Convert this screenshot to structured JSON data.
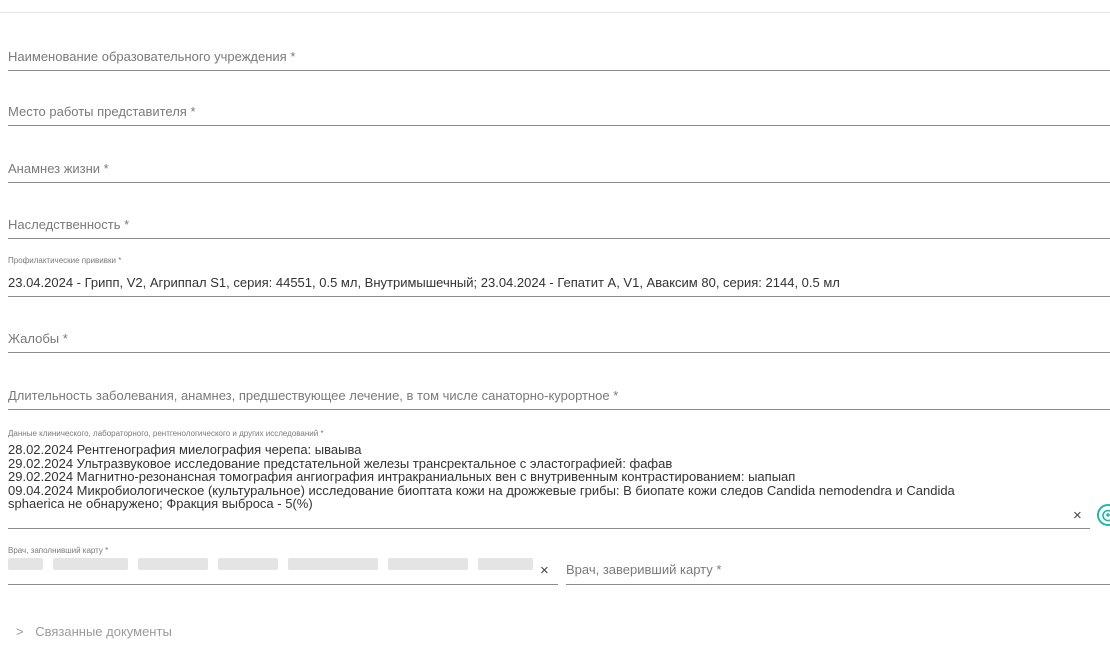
{
  "fields": {
    "education_institution": {
      "placeholder": "Наименование образовательного учреждения *"
    },
    "representative_workplace": {
      "placeholder": "Место работы представителя *"
    },
    "life_anamnesis": {
      "placeholder": "Анамнез жизни *"
    },
    "heredity": {
      "placeholder": "Наследственность *"
    },
    "vaccinations": {
      "label": "Профилактические прививки *",
      "value": "23.04.2024 - Грипп, V2, Агриппал S1, серия: 44551, 0.5 мл, Внутримышечный; 23.04.2024 - Гепатит А, V1, Аваксим 80, серия: 2144, 0.5 мл"
    },
    "complaints": {
      "placeholder": "Жалобы *"
    },
    "disease_duration": {
      "placeholder": "Длительность заболевания, анамнез, предшествующее лечение, в том числе санаторно-курортное *"
    },
    "research_data": {
      "label": "Данные клинического, лабораторного, рентгенологического и других исследований *",
      "lines": [
        "28.02.2024 Рентгенография миелография черепа: ываыва",
        "29.02.2024 Ультразвуковое исследование предстательной железы трансректальное с эластографией: фафав",
        "29.02.2024 Магнитно-резонансная томография ангиография интракраниальных вен с внутривенным контрастированием: ыапыап",
        "09.04.2024 Микробиологическое (культуральное) исследование биоптата кожи на дрожжевые грибы: В биопате кожи следов Candida nemodendra и Candida",
        "sphaerica не обнаружено; Фракция выброса - 5(%)"
      ],
      "clear_symbol": "×"
    },
    "doctor_filled": {
      "label": "Врач, заполнивший карту *",
      "clear_symbol": "×"
    },
    "doctor_certified": {
      "placeholder": "Врач, заверивший карту *"
    }
  },
  "related_documents": {
    "chevron": ">",
    "label": "Связанные документы"
  },
  "icons": {
    "action_button_icon": "refresh-add-icon",
    "accent_color": "#20b6a8"
  }
}
